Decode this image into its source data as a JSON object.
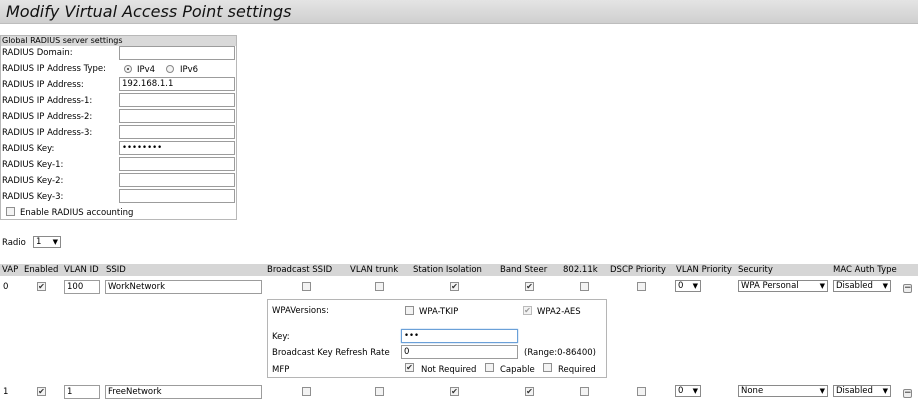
{
  "page_title": "Modify Virtual Access Point settings",
  "radius": {
    "header": "Global RADIUS server settings",
    "domain_label": "RADIUS Domain:",
    "domain_value": "",
    "ip_type_label": "RADIUS IP Address Type:",
    "ipv4_label": "IPv4",
    "ipv6_label": "IPv6",
    "ip_label": "RADIUS IP Address:",
    "ip_value": "192.168.1.1",
    "ip1_label": "RADIUS IP Address-1:",
    "ip2_label": "RADIUS IP Address-2:",
    "ip3_label": "RADIUS IP Address-3:",
    "key_label": "RADIUS Key:",
    "key_value": "••••••••",
    "key1_label": "RADIUS Key-1:",
    "key2_label": "RADIUS Key-2:",
    "key3_label": "RADIUS Key-3:",
    "accounting_label": "Enable RADIUS accounting"
  },
  "radio": {
    "label": "Radio",
    "value": "1"
  },
  "table": {
    "headers": {
      "vap": "VAP",
      "enabled": "Enabled",
      "vlan_id": "VLAN ID",
      "ssid": "SSID",
      "broadcast_ssid": "Broadcast SSID",
      "vlan_trunk": "VLAN trunk",
      "station_isolation": "Station Isolation",
      "band_steer": "Band Steer",
      "k80211": "802.11k",
      "dscp_priority": "DSCP Priority",
      "vlan_priority": "VLAN Priority",
      "security": "Security",
      "mac_auth_type": "MAC Auth Type"
    },
    "rows": [
      {
        "vap": "0",
        "vlan_id": "100",
        "ssid": "WorkNetwork",
        "vlan_priority": "0",
        "security": "WPA Personal",
        "mac_auth": "Disabled"
      },
      {
        "vap": "1",
        "vlan_id": "1",
        "ssid": "FreeNetwork",
        "vlan_priority": "0",
        "security": "None",
        "mac_auth": "Disabled"
      }
    ]
  },
  "wpa": {
    "versions_label": "WPAVersions:",
    "tkip_label": "WPA-TKIP",
    "aes_label": "WPA2-AES",
    "key_label": "Key:",
    "key_value": "•••",
    "refresh_label": "Broadcast Key Refresh Rate",
    "refresh_value": "0",
    "range_text": "(Range:0-86400)",
    "mfp_label": "MFP",
    "not_required_label": "Not Required",
    "capable_label": "Capable",
    "required_label": "Required"
  },
  "glyphs": {
    "check": "✔",
    "arrow": "▼",
    "minus": "−"
  }
}
